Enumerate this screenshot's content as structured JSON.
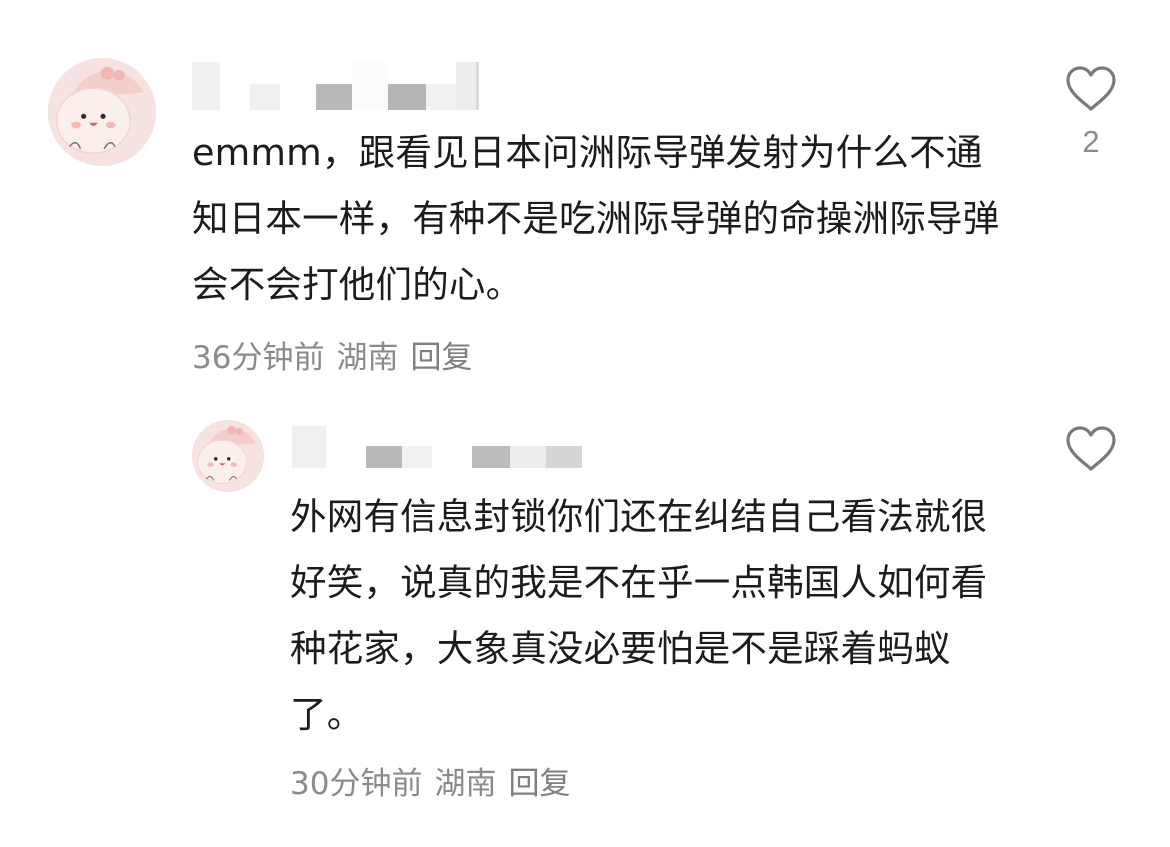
{
  "comments": [
    {
      "text": "emmm，跟看见日本问洲际导弹发射为什么不通知日本一样，有种不是吃洲际导弹的命操洲际导弹会不会打他们的心。",
      "time": "36分钟前",
      "location": "湖南",
      "reply_label": "回复",
      "like_count": "2",
      "avatar_icon": "cartoon-avatar-icon",
      "like_icon": "heart-outline-icon"
    },
    {
      "text": "外网有信息封锁你们还在纠结自己看法就很好笑，说真的我是不在乎一点韩国人如何看种花家，大象真没必要怕是不是踩着蚂蚁了。",
      "time": "30分钟前",
      "location": "湖南",
      "reply_label": "回复",
      "like_count": "",
      "avatar_icon": "cartoon-avatar-icon",
      "like_icon": "heart-outline-icon"
    }
  ],
  "colors": {
    "text": "#1c1c1c",
    "meta": "#8b8b8b",
    "icon": "#7a7a7a",
    "avatar_bg": "#f6e3e1"
  }
}
